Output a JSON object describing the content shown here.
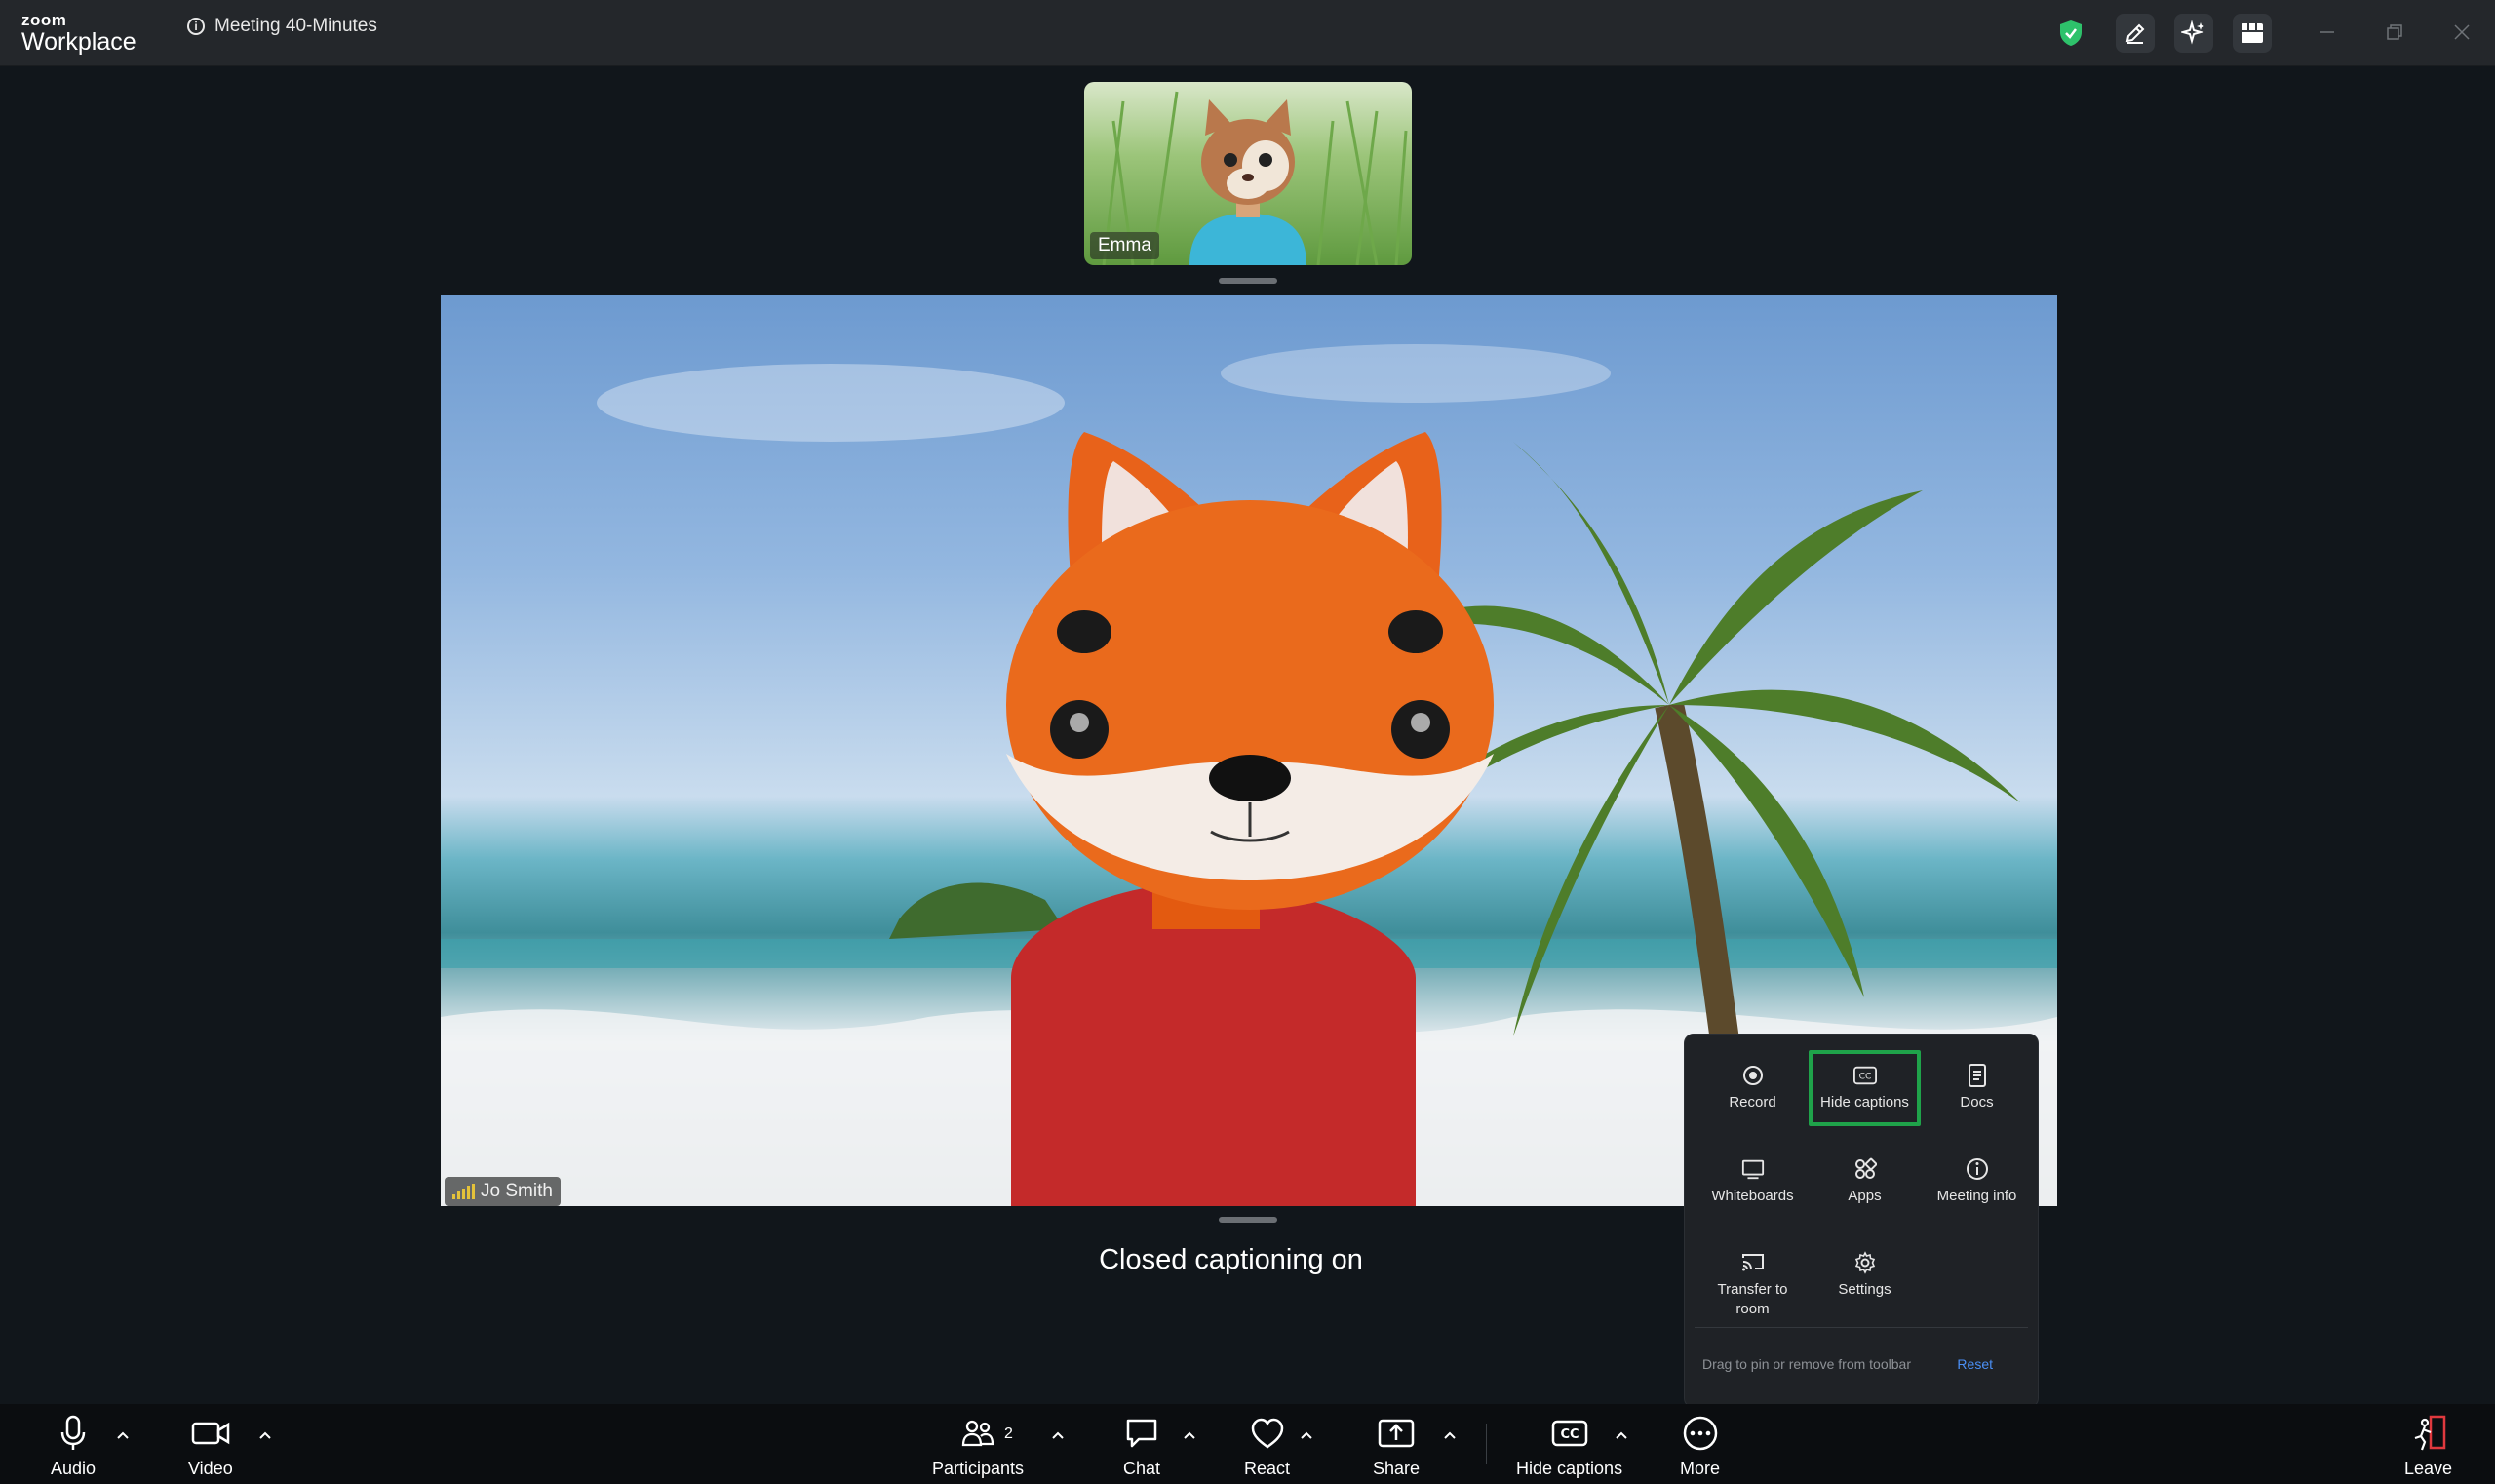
{
  "app": {
    "logo_small": "zoom",
    "logo_main": "Workplace"
  },
  "meeting": {
    "title": "Meeting 40-Minutes"
  },
  "participants_view": {
    "thumbnail_name": "Emma",
    "main_name": "Jo Smith"
  },
  "captions": {
    "text": "Closed captioning on"
  },
  "more_menu": {
    "items": [
      {
        "label": "Record",
        "icon": "record-icon"
      },
      {
        "label": "Hide captions",
        "icon": "cc-icon"
      },
      {
        "label": "Docs",
        "icon": "docs-icon"
      },
      {
        "label": "Whiteboards",
        "icon": "whiteboard-icon"
      },
      {
        "label": "Apps",
        "icon": "apps-icon"
      },
      {
        "label": "Meeting info",
        "icon": "info-icon"
      },
      {
        "label": "Transfer to room",
        "icon": "cast-icon"
      },
      {
        "label": "Settings",
        "icon": "gear-icon"
      }
    ],
    "footer_hint": "Drag to pin or remove from toolbar",
    "reset_label": "Reset"
  },
  "toolbar": {
    "audio": "Audio",
    "video": "Video",
    "participants": "Participants",
    "participants_count": "2",
    "chat": "Chat",
    "react": "React",
    "share": "Share",
    "hide_captions": "Hide captions",
    "more": "More",
    "leave": "Leave"
  },
  "colors": {
    "accent_green": "#1fa34a",
    "shield_green": "#2ec26b",
    "link_blue": "#4a8ff5",
    "leave_red": "#e0393e"
  }
}
